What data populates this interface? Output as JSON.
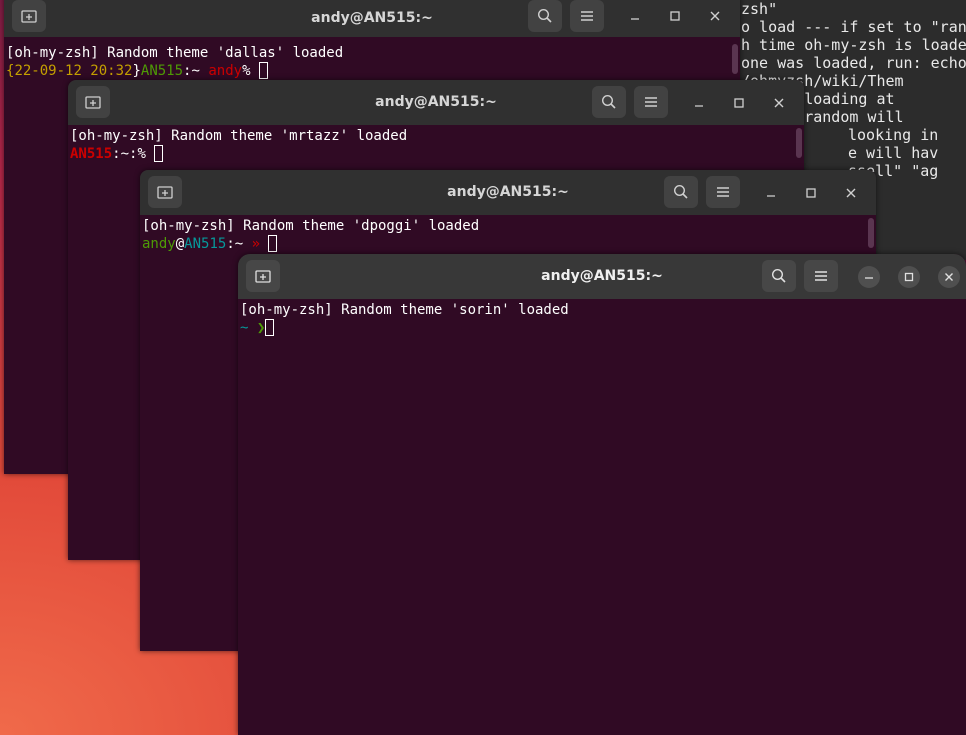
{
  "background_editor": {
    "lines": [
      "zsh\"",
      "",
      "o load --- if set to \"ran",
      "h time oh-my-zsh is loade",
      "one was loaded, run: echo",
      "/ohmyzsh/wiki/Them",
      "",
      "",
      "m when loading at",
      " THEME=random will",
      "looking in",
      "e will hav",
      "ssell\" \"ag",
      ""
    ]
  },
  "windows": [
    {
      "title": "andy@AN515:~",
      "message": "[oh-my-zsh] Random theme 'dallas' loaded",
      "prompt": {
        "brace_open": "{",
        "datetime": "22-09-12 20:32",
        "brace_close": "}",
        "host": "AN515",
        "sep": ":~ ",
        "user": "andy",
        "symbol": "% "
      }
    },
    {
      "title": "andy@AN515:~",
      "message": "[oh-my-zsh] Random theme 'mrtazz' loaded",
      "prompt": {
        "host": "AN515",
        "rest": ":~:% "
      }
    },
    {
      "title": "andy@AN515:~",
      "message": "[oh-my-zsh] Random theme 'dpoggi' loaded",
      "prompt": {
        "user": "andy",
        "at": "@",
        "host": "AN515",
        "sep": ":~ ",
        "symbol": "» "
      }
    },
    {
      "title": "andy@AN515:~",
      "message": "[oh-my-zsh] Random theme 'sorin' loaded",
      "prompt": {
        "tilde": "~ ",
        "symbol": "❯"
      }
    }
  ],
  "colors": {
    "terminal_bg": "#300a24",
    "titlebar": "#303030",
    "dallas_datetime": "#c4a000",
    "dallas_host": "#4e9a06",
    "dallas_user": "#cc0000",
    "mrtazz_host": "#cc0000",
    "dpoggi_user": "#4e9a06",
    "dpoggi_host": "#06989a",
    "dpoggi_symbol": "#cc0000",
    "sorin_tilde": "#06989a",
    "sorin_symbol": "#4e9a06"
  },
  "icons": {
    "new_tab": "new-tab-icon",
    "search": "search-icon",
    "menu": "hamburger-menu-icon",
    "minimize": "minimize-icon",
    "maximize": "maximize-icon",
    "close": "close-icon"
  }
}
